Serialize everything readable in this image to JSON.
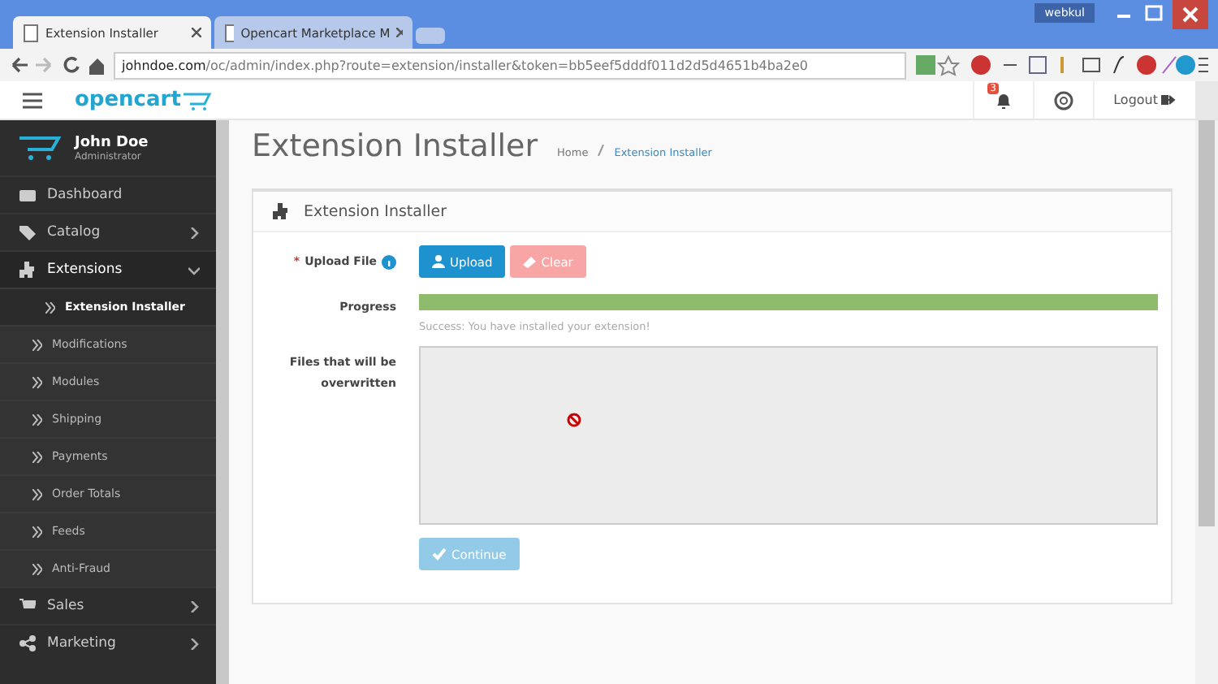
{
  "browser": {
    "tabs": [
      {
        "title": "Extension Installer",
        "selected": true
      },
      {
        "title": "Opencart Marketplace M",
        "selected": false
      }
    ],
    "user_badge": "webkul",
    "url_host": "johndoe.com",
    "url_path": "/oc/admin/index.php?route=extension/installer&token=bb5eef5dddf011d2d5d4651b4ba2e0"
  },
  "header": {
    "logo": "opencart",
    "notification_count": "3",
    "logout": "Logout"
  },
  "sidebar": {
    "user": {
      "name": "John Doe",
      "role": "Administrator"
    },
    "items": [
      {
        "label": "Dashboard",
        "expandable": false,
        "expanded": false
      },
      {
        "label": "Catalog",
        "expandable": true,
        "expanded": false
      },
      {
        "label": "Extensions",
        "expandable": true,
        "expanded": true,
        "children": [
          {
            "label": "Extension Installer",
            "selected": true
          },
          {
            "label": "Modifications",
            "selected": false
          },
          {
            "label": "Modules",
            "selected": false
          },
          {
            "label": "Shipping",
            "selected": false
          },
          {
            "label": "Payments",
            "selected": false
          },
          {
            "label": "Order Totals",
            "selected": false
          },
          {
            "label": "Feeds",
            "selected": false
          },
          {
            "label": "Anti-Fraud",
            "selected": false
          }
        ]
      },
      {
        "label": "Sales",
        "expandable": true,
        "expanded": false
      },
      {
        "label": "Marketing",
        "expandable": true,
        "expanded": false
      }
    ]
  },
  "page": {
    "title": "Extension Installer",
    "breadcrumbs": [
      "Home",
      "Extension Installer"
    ],
    "panel_title": "Extension Installer",
    "upload_label": "Upload File",
    "required_mark": "*",
    "buttons": [
      {
        "label": "Upload",
        "kind": "upload",
        "disabled": false
      },
      {
        "label": "Clear",
        "kind": "clear",
        "disabled": true
      }
    ],
    "progress_label": "Progress",
    "progress": {
      "level": 1
    },
    "message": "Success: You have installed your extension!",
    "files_label": "Files that will be overwritten",
    "continue": {
      "label": "Continue",
      "disabled": true
    }
  }
}
